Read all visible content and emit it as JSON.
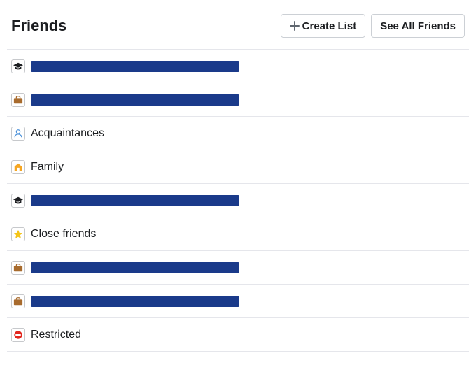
{
  "header": {
    "title": "Friends",
    "create_list": "Create List",
    "see_all": "See All Friends"
  },
  "lists": [
    {
      "icon": "education-icon",
      "label": "",
      "redacted": true,
      "redacted_width": 298
    },
    {
      "icon": "work-icon",
      "label": "",
      "redacted": true,
      "redacted_width": 298
    },
    {
      "icon": "person-icon",
      "label": "Acquaintances",
      "redacted": false
    },
    {
      "icon": "house-icon",
      "label": "Family",
      "redacted": false
    },
    {
      "icon": "education-icon",
      "label": "",
      "redacted": true,
      "redacted_width": 298
    },
    {
      "icon": "star-icon",
      "label": "Close friends",
      "redacted": false
    },
    {
      "icon": "work-icon",
      "label": "",
      "redacted": true,
      "redacted_width": 298
    },
    {
      "icon": "work-icon",
      "label": "",
      "redacted": true,
      "redacted_width": 298
    },
    {
      "icon": "restricted-icon",
      "label": "Restricted",
      "redacted": false
    }
  ],
  "colors": {
    "redaction": "#1a3a8a",
    "divider": "#e5e6eb",
    "btn_border": "#ccd0d5",
    "icon_border": "#c7c9cc"
  }
}
